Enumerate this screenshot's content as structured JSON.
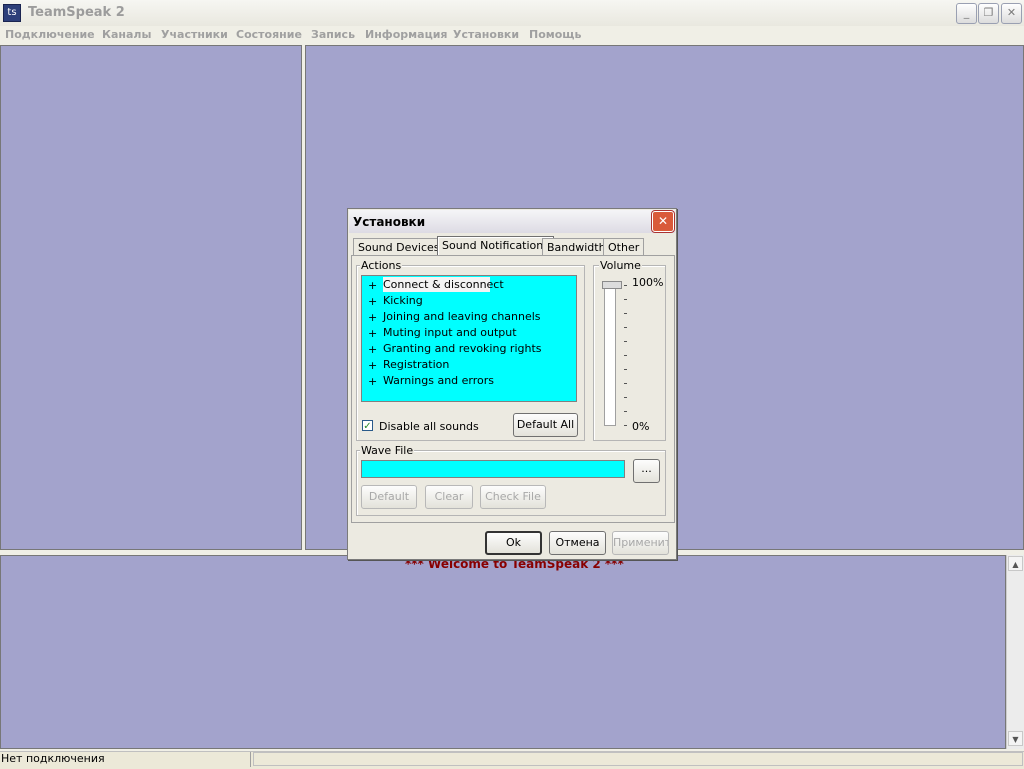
{
  "window": {
    "title": "TeamSpeak 2",
    "icon": "teamspeak-icon",
    "controls": {
      "minimize": "_",
      "restore": "❐",
      "close": "✕"
    }
  },
  "menu": [
    "Подключение",
    "Каналы",
    "Участники",
    "Состояние",
    "Запись",
    "Информация",
    "Установки",
    "Помощь"
  ],
  "chat": {
    "welcome": "*** Welcome to TeamSpeak 2 ***"
  },
  "scrollbar": {
    "up": "▲",
    "down": "▼"
  },
  "status": {
    "text": "Нет подключения"
  },
  "dialog": {
    "title": "Установки",
    "close": "✕",
    "tabs": [
      "Sound Devices",
      "Sound Notifications",
      "Bandwidth",
      "Other"
    ],
    "active_tab": "Sound Notifications",
    "actions": {
      "label": "Actions",
      "items": [
        "Connect & disconnect",
        "Kicking",
        "Joining and leaving  channels",
        "Muting input and output",
        "Granting and revoking rights",
        "Registration",
        "Warnings and errors"
      ],
      "selected": "Connect & disconnect",
      "expander": "+"
    },
    "disable_all_sounds": {
      "label": "Disable all sounds",
      "checked": true,
      "mark": "✓"
    },
    "default_all": "Default All",
    "volume": {
      "label": "Volume",
      "max_label": "100%",
      "min_label": "0%",
      "level": 1.0
    },
    "wave_file": {
      "label": "Wave File",
      "value": "",
      "browse": "...",
      "default": "Default",
      "clear": "Clear",
      "check_file": "Check File"
    },
    "buttons": {
      "ok": "Ok",
      "cancel": "Отмена",
      "apply": "Применить"
    }
  },
  "colors": {
    "pane": "#a3a3cc",
    "list_bg": "#00ffff",
    "welcome": "#880000"
  }
}
